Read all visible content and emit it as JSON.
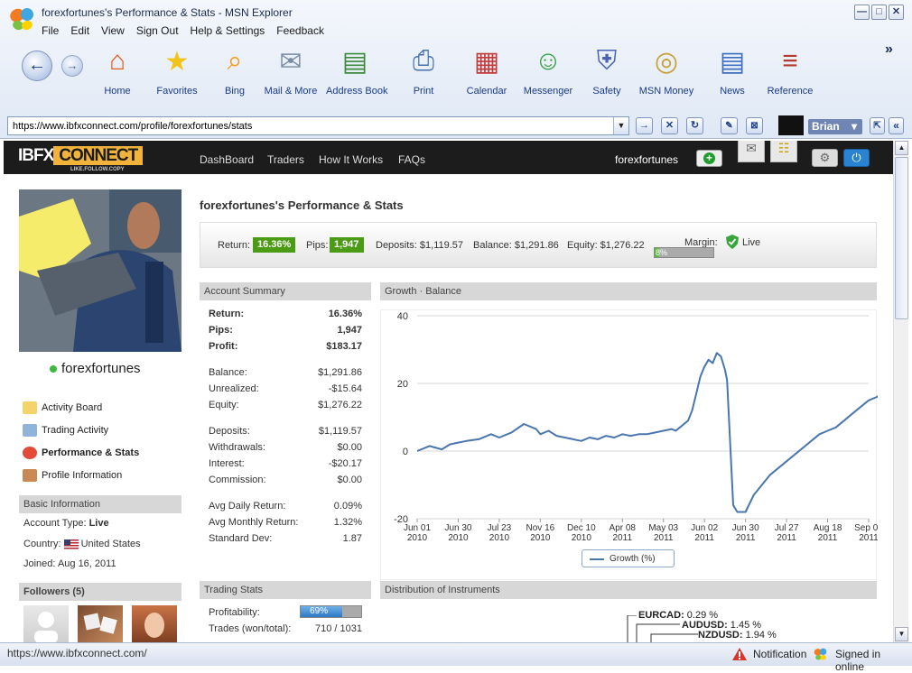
{
  "window": {
    "title": "forexfortunes's Performance & Stats - MSN Explorer",
    "controls": {
      "minimize": "—",
      "maximize": "□",
      "close": "✕"
    }
  },
  "menu": [
    "File",
    "Edit",
    "View",
    "Sign Out",
    "Help & Settings",
    "Feedback"
  ],
  "toolbar": {
    "back_icon": "←",
    "forward_icon": "→",
    "more_icon": "»",
    "items": [
      {
        "label": "Home",
        "icon": "house-icon",
        "glyph": "⌂",
        "color": "#e35a1b"
      },
      {
        "label": "Favorites",
        "icon": "star-icon",
        "glyph": "★",
        "color": "#f0c419"
      },
      {
        "label": "Bing",
        "icon": "bing-icon",
        "glyph": "⌕",
        "color": "#f59a13"
      },
      {
        "label": "Mail & More",
        "icon": "mail-icon",
        "glyph": "✉",
        "color": "#7a8ba6"
      },
      {
        "label": "Address Book",
        "icon": "address-book-icon",
        "glyph": "▤",
        "color": "#3c8a3c"
      },
      {
        "label": "Print",
        "icon": "printer-icon",
        "glyph": "⎙",
        "color": "#4470b0"
      },
      {
        "label": "Calendar",
        "icon": "calendar-icon",
        "glyph": "▦",
        "color": "#c23b3b"
      },
      {
        "label": "Messenger",
        "icon": "messenger-icon",
        "glyph": "☺",
        "color": "#2f9d3a"
      },
      {
        "label": "Safety",
        "icon": "shield-icon",
        "glyph": "⛨",
        "color": "#4a63b3"
      },
      {
        "label": "MSN Money",
        "icon": "coins-icon",
        "glyph": "◎",
        "color": "#c5a23a"
      },
      {
        "label": "News",
        "icon": "newspaper-icon",
        "glyph": "▤",
        "color": "#3d6fc0"
      },
      {
        "label": "Reference",
        "icon": "books-icon",
        "glyph": "≡",
        "color": "#b5392e"
      }
    ]
  },
  "address": {
    "url": "https://www.ibfxconnect.com/profile/forexfortunes/stats",
    "dropdown": "▼",
    "buttons": {
      "go": "→",
      "stop": "✕",
      "refresh": "↻"
    },
    "user": "Brian",
    "user_caret": "▾",
    "expand_icon": "⇱",
    "collapse_icon": "«"
  },
  "site": {
    "logo_prefix": "IBFX",
    "logo_main": "CONNECT",
    "logo_tag": "LIKE.FOLLOW.COPY",
    "nav": [
      "DashBoard",
      "Traders",
      "How It Works",
      "FAQs"
    ],
    "username": "forexfortunes",
    "plus": "+",
    "mail_glyph": "✉",
    "chat_glyph": "☷",
    "settings_glyph": "⚙",
    "power_glyph": "⏻"
  },
  "profile": {
    "name": "forexfortunes",
    "links": [
      {
        "label": "Activity Board",
        "icon": "activity-board-icon",
        "active": false
      },
      {
        "label": "Trading Activity",
        "icon": "trading-activity-icon",
        "active": false
      },
      {
        "label": "Performance & Stats",
        "icon": "pie-chart-icon",
        "active": true
      },
      {
        "label": "Profile Information",
        "icon": "person-icon",
        "active": false
      }
    ],
    "basic_info_title": "Basic Information",
    "account_type_label": "Account Type:",
    "account_type": "Live",
    "country_label": "Country:",
    "country": "United States",
    "joined_label": "Joined:",
    "joined": "Aug 16, 2011",
    "followers_title": "Followers (5)"
  },
  "stats": {
    "title": "forexfortunes's Performance & Stats",
    "return_label": "Return:",
    "return_value": "16.36%",
    "pips_label": "Pips:",
    "pips_value": "1,947",
    "deposits": "Deposits: $1,119.57",
    "balance": "Balance: $1,291.86",
    "equity": "Equity: $1,276.22",
    "margin_label": "Margin:",
    "margin_value": "8%",
    "margin_fraction": 0.08,
    "live_label": "Live"
  },
  "account_summary": {
    "title": "Account Summary",
    "rows": [
      {
        "label": "Return:",
        "value": "16.36%",
        "bold": true
      },
      {
        "label": "Pips:",
        "value": "1,947",
        "bold": true
      },
      {
        "label": "Profit:",
        "value": "$183.17",
        "bold": true
      },
      {
        "label": "Balance:",
        "value": "$1,291.86",
        "bold": false
      },
      {
        "label": "Unrealized:",
        "value": "-$15.64",
        "bold": false
      },
      {
        "label": "Equity:",
        "value": "$1,276.22",
        "bold": false
      },
      {
        "label": "Deposits:",
        "value": "$1,119.57",
        "bold": false
      },
      {
        "label": "Withdrawals:",
        "value": "$0.00",
        "bold": false
      },
      {
        "label": "Interest:",
        "value": "-$20.17",
        "bold": false
      },
      {
        "label": "Commission:",
        "value": "$0.00",
        "bold": false
      },
      {
        "label": "Avg Daily Return:",
        "value": "0.09%",
        "bold": false
      },
      {
        "label": "Avg Monthly Return:",
        "value": "1.32%",
        "bold": false
      },
      {
        "label": "Standard Dev:",
        "value": "1.87",
        "bold": false
      }
    ]
  },
  "trading_stats": {
    "title": "Trading Stats",
    "profitability_label": "Profitability:",
    "profitability_value": "69%",
    "profitability_fraction": 0.69,
    "trades_label": "Trades (won/total):",
    "trades_value": "710 / 1031"
  },
  "growth_panel_title": "Growth · Balance",
  "distribution_title": "Distribution of Instruments",
  "distribution_labels": [
    {
      "name": "EURCAD",
      "pct": "0.29 %"
    },
    {
      "name": "AUDUSD",
      "pct": "1.45 %"
    },
    {
      "name": "NZDUSD",
      "pct": "1.94 %"
    }
  ],
  "chart_data": {
    "type": "line",
    "title": "",
    "xlabel": "",
    "ylabel": "",
    "ylim": [
      -20,
      40
    ],
    "yticks": [
      "40",
      "20",
      "0",
      "-20"
    ],
    "xticks": [
      {
        "l1": "Jun 01",
        "l2": "2010"
      },
      {
        "l1": "Jun 30",
        "l2": "2010"
      },
      {
        "l1": "Jul 23",
        "l2": "2010"
      },
      {
        "l1": "Nov 16",
        "l2": "2010"
      },
      {
        "l1": "Dec 10",
        "l2": "2010"
      },
      {
        "l1": "Apr 08",
        "l2": "2011"
      },
      {
        "l1": "May 03",
        "l2": "2011"
      },
      {
        "l1": "Jun 02",
        "l2": "2011"
      },
      {
        "l1": "Jun 30",
        "l2": "2011"
      },
      {
        "l1": "Jul 27",
        "l2": "2011"
      },
      {
        "l1": "Aug 18",
        "l2": "2011"
      },
      {
        "l1": "Sep 08",
        "l2": "2011"
      }
    ],
    "legend": "top-bottom-center",
    "series": [
      {
        "name": "Growth (%)",
        "color": "#4a76ae",
        "x": [
          0,
          0.3,
          0.6,
          0.8,
          1,
          1.2,
          1.5,
          1.8,
          2,
          2.3,
          2.6,
          2.9,
          3,
          3.2,
          3.4,
          3.6,
          3.8,
          4,
          4.2,
          4.4,
          4.6,
          4.8,
          5,
          5.2,
          5.4,
          5.6,
          5.8,
          6,
          6.2,
          6.3,
          6.4,
          6.5,
          6.6,
          6.7,
          6.8,
          6.9,
          7,
          7.1,
          7.2,
          7.3,
          7.4,
          7.5,
          7.55,
          7.7,
          7.8,
          8,
          8.2,
          8.4,
          8.6,
          8.8,
          9,
          9.2,
          9.4,
          9.6,
          9.8,
          10,
          10.2,
          10.4,
          10.6,
          10.8,
          11,
          11.2,
          11.3,
          11.4
        ],
        "y": [
          0,
          1.5,
          0.5,
          2,
          2.5,
          3,
          3.5,
          5,
          4,
          5.5,
          8,
          6.5,
          5,
          6,
          4.5,
          4,
          3.5,
          3,
          4,
          3.5,
          4.5,
          4,
          5,
          4.5,
          5,
          5,
          5.5,
          6,
          6.5,
          6,
          7,
          8,
          9,
          12,
          17,
          22,
          25,
          27,
          26,
          29,
          28,
          24,
          21,
          -16,
          -18,
          -18,
          -13,
          -10,
          -7,
          -5,
          -3,
          -1,
          1,
          3,
          5,
          6,
          7,
          9,
          11,
          13,
          15,
          16,
          17,
          16.5
        ]
      }
    ]
  },
  "status_bar": {
    "url": "https://www.ibfxconnect.com/",
    "notification": "Notification",
    "signin": "Signed in online"
  }
}
